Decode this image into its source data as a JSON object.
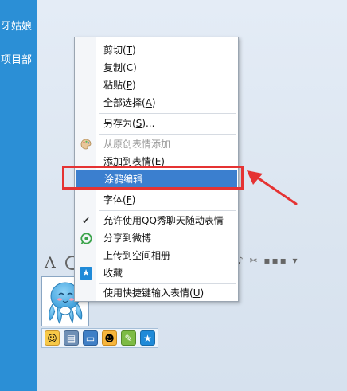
{
  "sidebar": {
    "items": [
      {
        "label": "牙姑娘"
      },
      {
        "label": "项目部"
      }
    ]
  },
  "toolbar": {
    "font_label": "A"
  },
  "context_menu": {
    "items": [
      {
        "label": "剪切(",
        "key": "T",
        "tail": ")"
      },
      {
        "label": "复制(",
        "key": "C",
        "tail": ")"
      },
      {
        "label": "粘贴(",
        "key": "P",
        "tail": ")"
      },
      {
        "label": "全部选择(",
        "key": "A",
        "tail": ")"
      },
      {
        "label": "另存为(",
        "key": "S",
        "tail": ")..."
      },
      {
        "label": "从原创表情添加",
        "disabled": true
      },
      {
        "label": "添加到表情(",
        "key": "E",
        "tail": ")"
      },
      {
        "label": "涂鸦编辑",
        "highlighted": true
      },
      {
        "label": "字体(",
        "key": "F",
        "tail": ")"
      },
      {
        "label": "允许使用QQ秀聊天随动表情",
        "checked": true
      },
      {
        "label": "分享到微博"
      },
      {
        "label": "上传到空间相册"
      },
      {
        "label": "收藏"
      },
      {
        "label": "使用快捷键输入表情(",
        "key": "U",
        "tail": ")"
      }
    ]
  },
  "colors": {
    "sidebar": "#2b8fd6",
    "highlight": "#3b7fcf",
    "annotation": "#e53333"
  },
  "icons": {
    "sticker": "octopus-sticker-icon",
    "gutter_palette": "palette-icon",
    "gutter_check": "checkmark-icon",
    "gutter_weibo": "weibo-icon",
    "gutter_favorite": "favorite-icon"
  }
}
